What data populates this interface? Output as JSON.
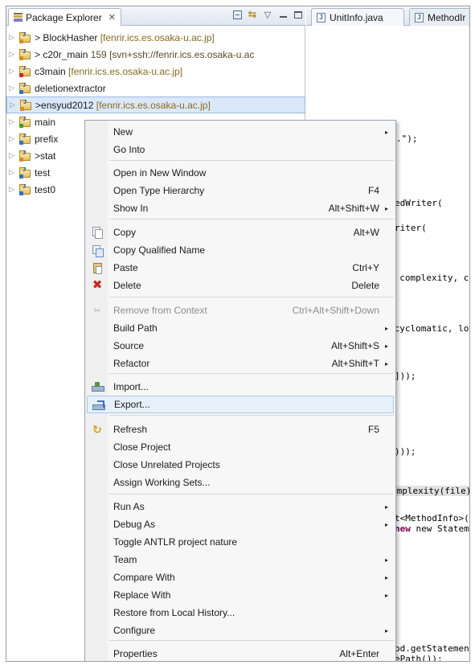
{
  "package_explorer": {
    "tab_label": "Package Explorer",
    "tab_close": "✕",
    "toolbar_icons": [
      "collapse-all-icon",
      "link-with-editor-icon",
      "view-menu-icon",
      "minimize-icon",
      "maximize-icon"
    ],
    "view_menu_glyph": "▽",
    "projects": [
      {
        "prefix": "> ",
        "name": "BlockHasher",
        "suffix": "  [fenrir.ics.es.osaka-u.ac.jp]",
        "badge": "orange",
        "selected": false
      },
      {
        "prefix": "> ",
        "name": "c20r_main",
        "suffix": " 159 [svn+ssh://fenrir.ics.es.osaka-u.ac",
        "badge": "orange",
        "selected": false
      },
      {
        "prefix": "",
        "name": "c3main",
        "suffix": "  [fenrir.ics.es.osaka-u.ac.jp]",
        "badge": "red",
        "selected": false
      },
      {
        "prefix": "",
        "name": "deletionextractor",
        "suffix": "",
        "badge": "blue",
        "selected": false
      },
      {
        "prefix": ">",
        "name": "ensyud2012",
        "suffix": "  [fenrir.ics.es.osaka-u.ac.jp]",
        "badge": "orange",
        "selected": true
      },
      {
        "prefix": "",
        "name": "main",
        "suffix": "",
        "badge": "green",
        "selected": false
      },
      {
        "prefix": "",
        "name": "prefix",
        "suffix": "",
        "badge": "blue",
        "selected": false
      },
      {
        "prefix": ">",
        "name": "stat",
        "suffix": "",
        "badge": "orange",
        "selected": false
      },
      {
        "prefix": "",
        "name": "test",
        "suffix": "",
        "badge": "blue",
        "selected": false
      },
      {
        "prefix": "",
        "name": "test0",
        "suffix": "",
        "badge": "blue",
        "selected": false
      }
    ]
  },
  "editor": {
    "tabs": [
      {
        "label": "UnitInfo.java"
      },
      {
        "label": "MethodIr"
      }
    ],
    "code_fragments": [
      {
        "text": ".\");"
      },
      {
        "text": "edWriter("
      },
      {
        "text": "riter("
      },
      {
        "text": ", complexity, c"
      },
      {
        "text": " cyclomatic, lo"
      },
      {
        "text": "]));"
      },
      {
        "text": ")));"
      },
      {
        "text": "omplexity(file)"
      },
      {
        "text": "t<MethodInfo>()"
      },
      {
        "text": " new StatementC"
      },
      {
        "text": "od.getStatement"
      },
      {
        "text": "ePath());"
      }
    ],
    "keyword_new": "new"
  },
  "context_menu": {
    "items": [
      {
        "label": "New",
        "accel": "",
        "submenu": true,
        "icon": "",
        "disabled": false
      },
      {
        "label": "Go Into",
        "accel": "",
        "submenu": false,
        "icon": "",
        "disabled": false
      },
      {
        "label": "Open in New Window",
        "accel": "",
        "submenu": false,
        "icon": "",
        "disabled": false
      },
      {
        "label": "Open Type Hierarchy",
        "accel": "F4",
        "submenu": false,
        "icon": "",
        "disabled": false
      },
      {
        "label": "Show In",
        "accel": "Alt+Shift+W",
        "submenu": true,
        "icon": "",
        "disabled": false
      },
      {
        "label": "Copy",
        "accel": "Alt+W",
        "submenu": false,
        "icon": "copy-icon",
        "disabled": false
      },
      {
        "label": "Copy Qualified Name",
        "accel": "",
        "submenu": false,
        "icon": "copy-qualified-name-icon",
        "disabled": false
      },
      {
        "label": "Paste",
        "accel": "Ctrl+Y",
        "submenu": false,
        "icon": "paste-icon",
        "disabled": false
      },
      {
        "label": "Delete",
        "accel": "Delete",
        "submenu": false,
        "icon": "delete-icon",
        "disabled": false
      },
      {
        "label": "Remove from Context",
        "accel": "Ctrl+Alt+Shift+Down",
        "submenu": false,
        "icon": "remove-context-icon",
        "disabled": true
      },
      {
        "label": "Build Path",
        "accel": "",
        "submenu": true,
        "icon": "",
        "disabled": false
      },
      {
        "label": "Source",
        "accel": "Alt+Shift+S",
        "submenu": true,
        "icon": "",
        "disabled": false
      },
      {
        "label": "Refactor",
        "accel": "Alt+Shift+T",
        "submenu": true,
        "icon": "",
        "disabled": false
      },
      {
        "label": "Import...",
        "accel": "",
        "submenu": false,
        "icon": "import-icon",
        "disabled": false
      },
      {
        "label": "Export...",
        "accel": "",
        "submenu": false,
        "icon": "export-icon",
        "disabled": false,
        "hover": true
      },
      {
        "label": "Refresh",
        "accel": "F5",
        "submenu": false,
        "icon": "refresh-icon",
        "disabled": false
      },
      {
        "label": "Close Project",
        "accel": "",
        "submenu": false,
        "icon": "",
        "disabled": false
      },
      {
        "label": "Close Unrelated Projects",
        "accel": "",
        "submenu": false,
        "icon": "",
        "disabled": false
      },
      {
        "label": "Assign Working Sets...",
        "accel": "",
        "submenu": false,
        "icon": "",
        "disabled": false
      },
      {
        "label": "Run As",
        "accel": "",
        "submenu": true,
        "icon": "",
        "disabled": false
      },
      {
        "label": "Debug As",
        "accel": "",
        "submenu": true,
        "icon": "",
        "disabled": false
      },
      {
        "label": "Toggle ANTLR project nature",
        "accel": "",
        "submenu": false,
        "icon": "",
        "disabled": false
      },
      {
        "label": "Team",
        "accel": "",
        "submenu": true,
        "icon": "",
        "disabled": false
      },
      {
        "label": "Compare With",
        "accel": "",
        "submenu": true,
        "icon": "",
        "disabled": false
      },
      {
        "label": "Replace With",
        "accel": "",
        "submenu": true,
        "icon": "",
        "disabled": false
      },
      {
        "label": "Restore from Local History...",
        "accel": "",
        "submenu": false,
        "icon": "",
        "disabled": false
      },
      {
        "label": "Configure",
        "accel": "",
        "submenu": true,
        "icon": "",
        "disabled": false
      },
      {
        "label": "Properties",
        "accel": "Alt+Enter",
        "submenu": false,
        "icon": "",
        "disabled": false
      }
    ],
    "submenu_arrow": "▸"
  },
  "colors": {
    "selection": "#dbe8f9",
    "menu_hover": "#e6f0fb",
    "keyword": "#7f0055",
    "delete_icon": "#d2231a"
  }
}
